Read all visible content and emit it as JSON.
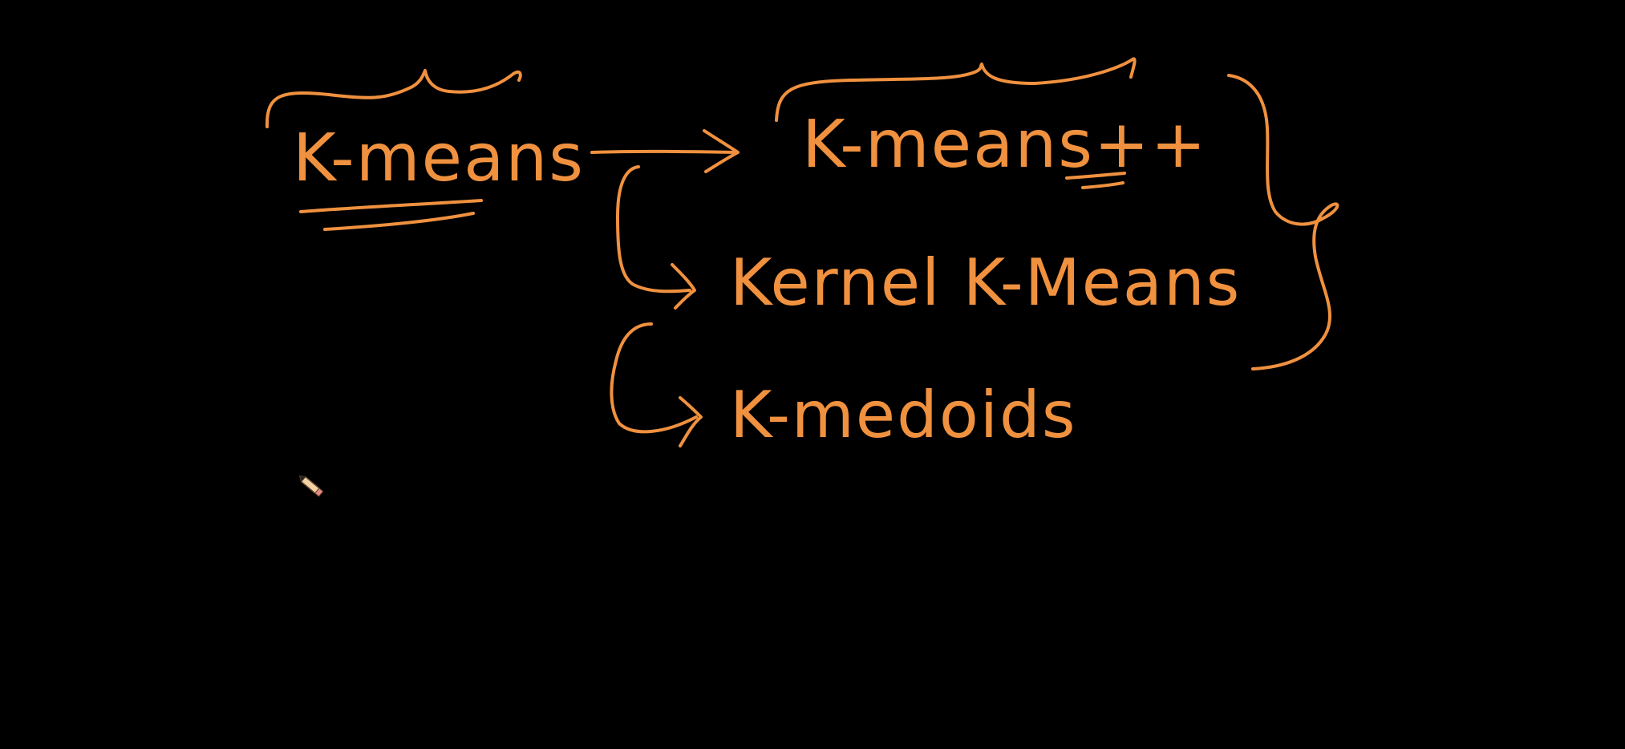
{
  "board": {
    "background_color": "#000000",
    "ink_color": "#f0913f"
  },
  "labels": {
    "root": "K-means",
    "variant_1": "K-means++",
    "variant_2": "Kernel K-Means",
    "variant_3": "K-medoids"
  },
  "icons": {
    "cursor": "pencil-cursor-icon"
  }
}
